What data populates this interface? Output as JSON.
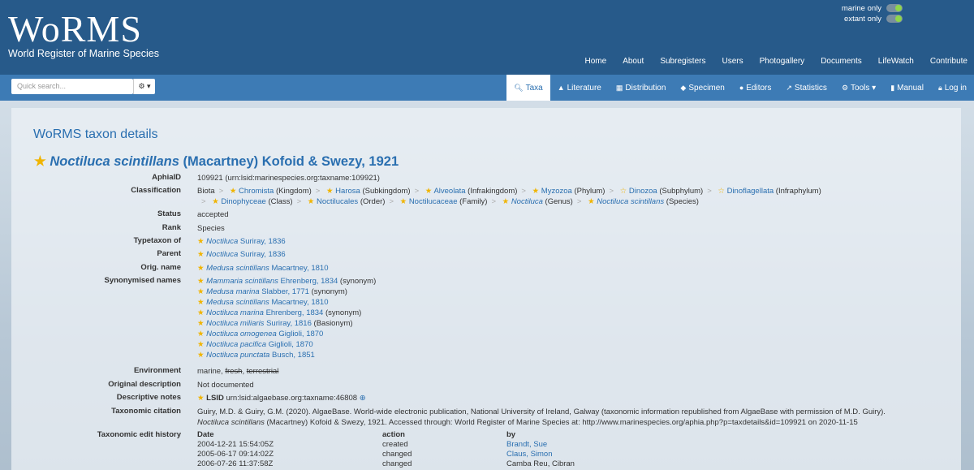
{
  "logo": {
    "title": "WoRMS",
    "subtitle": "World Register of Marine Species"
  },
  "toggles": [
    {
      "label": "marine only"
    },
    {
      "label": "extant only"
    }
  ],
  "topnav": [
    "Home",
    "About",
    "Subregisters",
    "Users",
    "Photogallery",
    "Documents",
    "LifeWatch",
    "Contribute"
  ],
  "search": {
    "placeholder": "Quick search..."
  },
  "tabs": [
    {
      "label": "Taxa",
      "icon": "search-icon"
    },
    {
      "label": "Literature",
      "icon": "graduation-cap-icon"
    },
    {
      "label": "Distribution",
      "icon": "map-icon"
    },
    {
      "label": "Specimen",
      "icon": "tag-icon"
    },
    {
      "label": "Editors",
      "icon": "users-icon"
    },
    {
      "label": "Statistics",
      "icon": "chart-icon"
    },
    {
      "label": "Tools",
      "icon": "cogs-icon"
    },
    {
      "label": "Manual",
      "icon": "book-icon"
    },
    {
      "label": "Log in",
      "icon": "lock-icon"
    }
  ],
  "page": {
    "title": "WoRMS taxon details",
    "taxon_genus_species": "Noctiluca scintillans",
    "taxon_authority": "(Macartney) Kofoid & Swezy, 1921"
  },
  "labels": {
    "aphia": "AphiaID",
    "classification": "Classification",
    "status": "Status",
    "rank": "Rank",
    "typetaxon": "Typetaxon of",
    "parent": "Parent",
    "orig": "Orig. name",
    "synonyms": "Synonymised names",
    "environment": "Environment",
    "origdesc": "Original description",
    "descnotes": "Descriptive notes",
    "citation": "Taxonomic citation",
    "history": "Taxonomic edit history"
  },
  "aphia_id": "109921  (urn:lsid:marinespecies.org:taxname:109921)",
  "classification_root": "Biota",
  "classification": [
    {
      "name": "Chromista",
      "rank": "(Kingdom)"
    },
    {
      "name": "Harosa",
      "rank": "(Subkingdom)"
    },
    {
      "name": "Alveolata",
      "rank": "(Infrakingdom)"
    },
    {
      "name": "Myzozoa",
      "rank": "(Phylum)"
    },
    {
      "name": "Dinozoa",
      "rank": "(Subphylum)"
    },
    {
      "name": "Dinoflagellata",
      "rank": "(Infraphylum)"
    },
    {
      "name": "Dinophyceae",
      "rank": "(Class)"
    },
    {
      "name": "Noctilucales",
      "rank": "(Order)"
    },
    {
      "name": "Noctilucaceae",
      "rank": "(Family)"
    },
    {
      "name": "Noctiluca",
      "rank": "(Genus)"
    },
    {
      "name": "Noctiluca scintillans",
      "rank": "(Species)"
    }
  ],
  "status": "accepted",
  "rank": "Species",
  "typetaxon": {
    "genus": "Noctiluca",
    "author": "Suriray, 1836"
  },
  "parent": {
    "genus": "Noctiluca",
    "author": "Suriray, 1836"
  },
  "orig_name": {
    "name": "Medusa scintillans",
    "author": "Macartney, 1810"
  },
  "synonyms": [
    {
      "name": "Mammaria scintillans",
      "author": "Ehrenberg, 1834",
      "note": "(synonym)"
    },
    {
      "name": "Medusa marina",
      "author": "Slabber, 1771",
      "note": "(synonym)"
    },
    {
      "name": "Medusa scintillans",
      "author": "Macartney, 1810",
      "note": ""
    },
    {
      "name": "Noctiluca marina",
      "author": "Ehrenberg, 1834",
      "note": "(synonym)"
    },
    {
      "name": "Noctiluca miliaris",
      "author": "Suriray, 1816",
      "note": "(Basionym)"
    },
    {
      "name": "Noctiluca omogenea",
      "author": "Giglioli, 1870",
      "note": ""
    },
    {
      "name": "Noctiluca pacifica",
      "author": "Giglioli, 1870",
      "note": ""
    },
    {
      "name": "Noctiluca punctata",
      "author": "Busch, 1851",
      "note": ""
    }
  ],
  "environment": {
    "marine": "marine,",
    "fresh": "fresh",
    "terrestrial": "terrestrial"
  },
  "original_description": "Not documented",
  "descriptive_notes": {
    "lsid_label": "LSID",
    "lsid": "urn:lsid:algaebase.org:taxname:46808"
  },
  "citation": {
    "line1": "Guiry, M.D. & Guiry, G.M. (2020). AlgaeBase. World-wide electronic publication, National University of Ireland, Galway (taxonomic information republished from AlgaeBase with permission of M.D. Guiry).",
    "line2_taxon": "Noctiluca scintillans",
    "line2_rest": "(Macartney) Kofoid & Swezy, 1921. Accessed through: World Register of Marine Species at: http://www.marinespecies.org/aphia.php?p=taxdetails&id=109921 on 2020-11-15"
  },
  "history": {
    "headers": {
      "date": "Date",
      "action": "action",
      "by": "by"
    },
    "rows": [
      {
        "date": "2004-12-21 15:54:05Z",
        "action": "created",
        "by": "Brandt, Sue"
      },
      {
        "date": "2005-06-17 09:14:02Z",
        "action": "changed",
        "by": "Claus, Simon"
      },
      {
        "date": "2006-07-26 11:37:58Z",
        "action": "changed",
        "by": "Camba Reu, Cibran"
      }
    ]
  }
}
